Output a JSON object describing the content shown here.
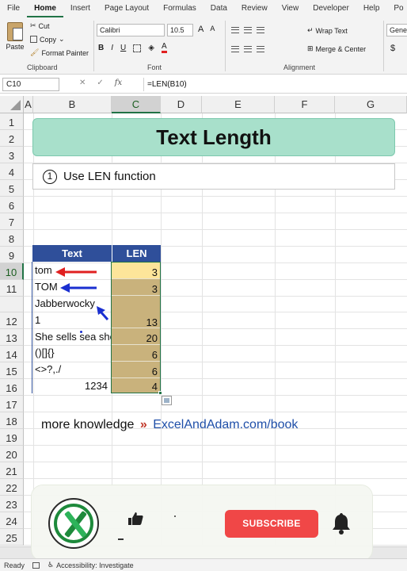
{
  "menu": {
    "tabs": [
      "File",
      "Home",
      "Insert",
      "Page Layout",
      "Formulas",
      "Data",
      "Review",
      "View",
      "Developer",
      "Help",
      "Po"
    ],
    "active": "Home"
  },
  "ribbon": {
    "clipboard": {
      "paste": "Paste",
      "cut": "Cut",
      "copy": "Copy",
      "format_painter": "Format Painter",
      "label": "Clipboard"
    },
    "font": {
      "name": "Calibri",
      "size": "10.5",
      "bold": "B",
      "italic": "I",
      "underline": "U",
      "grow": "A",
      "shrink": "A",
      "label": "Font"
    },
    "alignment": {
      "wrap_text": "Wrap Text",
      "merge_center": "Merge & Center",
      "label": "Alignment"
    },
    "number": {
      "format": "Genera",
      "currency": "$"
    }
  },
  "formula_bar": {
    "name_box": "C10",
    "cancel": "✕",
    "enter": "✓",
    "fx": "fx",
    "formula": "=LEN(B10)"
  },
  "columns": [
    "A",
    "B",
    "C",
    "D",
    "E",
    "F",
    "G"
  ],
  "rows": [
    "1",
    "2",
    "3",
    "4",
    "5",
    "6",
    "7",
    "8",
    "9",
    "10",
    "11",
    "",
    "12",
    "13",
    "14",
    "15",
    "16",
    "17",
    "18",
    "19",
    "20",
    "21",
    "22",
    "23",
    "24",
    "25"
  ],
  "sheet": {
    "title": "Text Length",
    "step_number": "1",
    "step_text": "Use LEN function",
    "table": {
      "header_text": "Text",
      "header_len": "LEN",
      "rows": [
        {
          "text": "tom",
          "len": "3"
        },
        {
          "text": "TOM",
          "len": "3"
        },
        {
          "text": "Jabberwocky",
          "len": ""
        },
        {
          "text": "1",
          "len": "13"
        },
        {
          "text": "She sells sea she",
          "len": "20"
        },
        {
          "text": "()[]{}",
          "len": "6"
        },
        {
          "text": "<>?,./",
          "len": "6"
        },
        {
          "text": "1234",
          "len": "4"
        }
      ]
    },
    "knowledge_prefix": "more knowledge",
    "knowledge_sep": "»",
    "knowledge_link": "ExcelAndAdam.com/book"
  },
  "overlay": {
    "subscribe_label": "SUBSCRIBE",
    "icons": [
      "excel-logo-icon",
      "thumbs-up-icon",
      "bell-icon"
    ]
  },
  "status": {
    "ready": "Ready",
    "accessibility": "Accessibility: Investigate"
  },
  "colors": {
    "accent": "#217346",
    "title_fill": "#a8e0cb",
    "table_header": "#2f4f9a",
    "len_fill": "#c9b27c",
    "active_cell": "#fde59a",
    "arrow_red": "#e02020",
    "arrow_blue": "#1a2fd0",
    "subscribe": "#f04747"
  }
}
